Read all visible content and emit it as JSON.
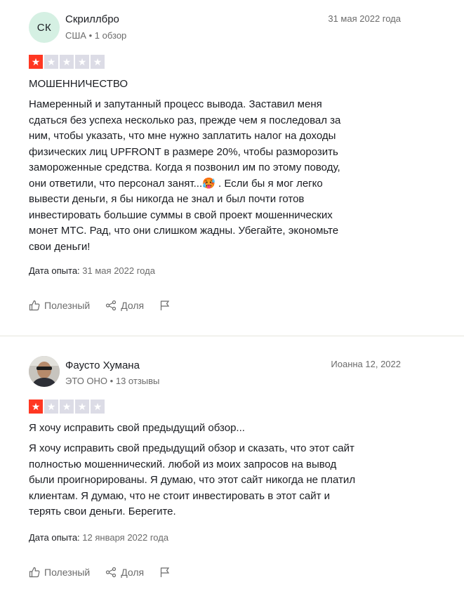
{
  "reviews": [
    {
      "avatar_initials": "СК",
      "name": "Скриллбро",
      "country": "США",
      "review_count": "1 обзор",
      "date": "31 мая 2022 года",
      "rating": 1,
      "title": "МОШЕННИЧЕСТВО",
      "body": "Намеренный и запутанный процесс вывода. Заставил меня\nсдаться без успеха несколько раз, прежде чем я последовал за\nним, чтобы указать, что мне нужно заплатить налог на доходы\nфизических лиц UPFRONT в размере 20%, чтобы разморозить\nзамороженные средства. Когда я позвонил им по этому поводу,\nони ответили, что персонал занят...🥵 . Если бы я мог легко\nвывести деньги, я бы никогда не знал и был почти готов\nинвестировать большие суммы в свой проект мошеннических\nмонет МТС. Рад, что они слишком жадны. Убегайте, экономьте\nсвои деньги!",
      "experience_label": "Дата опыта:",
      "experience_date": "31 мая 2022 года",
      "useful_label": "Полезный",
      "share_label": "Доля"
    },
    {
      "name": "Фаусто Хумана",
      "country": "ЭТО ОНО",
      "review_count": "13 отзывы",
      "date": "Иоанна 12, 2022",
      "rating": 1,
      "title": "Я хочу исправить свой предыдущий обзор...",
      "body": "Я хочу исправить свой предыдущий обзор и сказать, что этот сайт\nполностью мошеннический. любой из моих запросов на вывод\nбыли проигнорированы. Я думаю, что этот сайт никогда не платил\nклиентам. Я думаю, что не стоит инвестировать в этот сайт и\nтерять свои деньги. Берегите.",
      "experience_label": "Дата опыта:",
      "experience_date": "12 января 2022 года",
      "useful_label": "Полезный",
      "share_label": "Доля"
    }
  ],
  "colors": {
    "star_on": "#ff3722",
    "star_off": "#dcdce6",
    "avatar_bg": "#d5f0e3"
  },
  "icons": [
    "thumbs-up-icon",
    "share-icon",
    "flag-icon",
    "star-icon"
  ],
  "separator": "•"
}
